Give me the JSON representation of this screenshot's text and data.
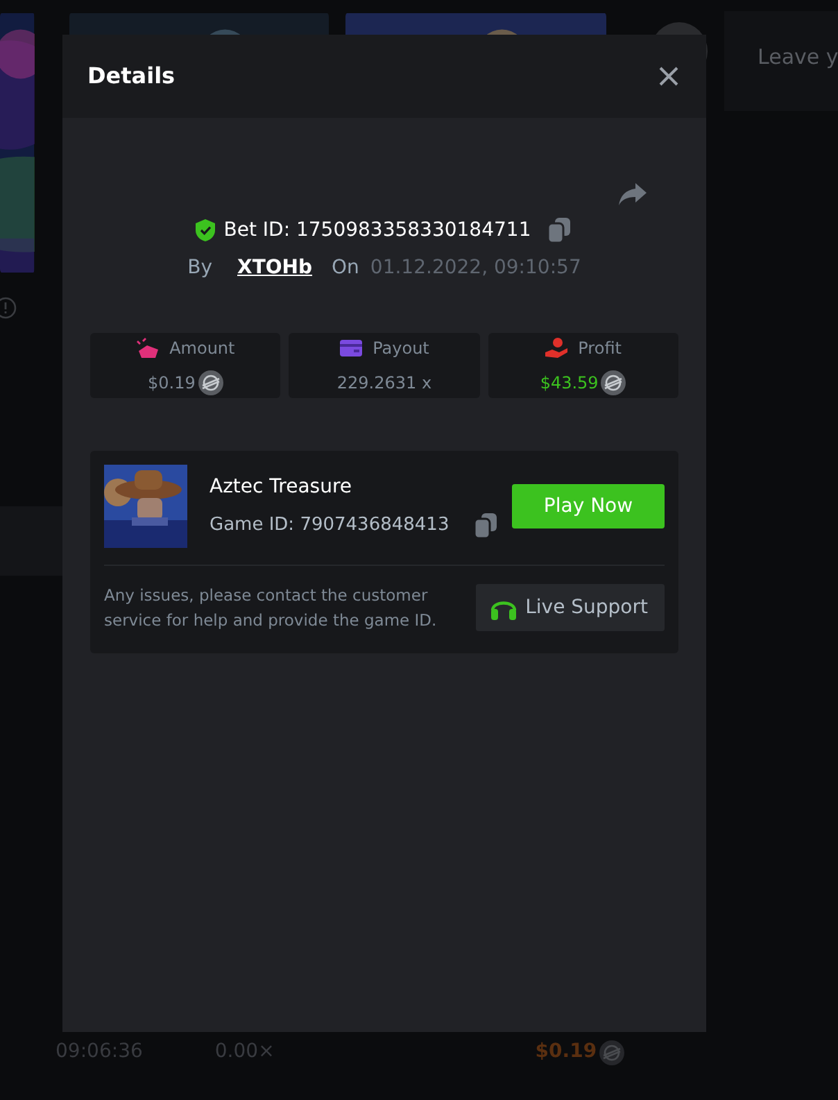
{
  "background": {
    "search_placeholder": "Leave y",
    "last_row": {
      "time": "09:06:36",
      "multiplier": "0.00×",
      "amount": "$0.19"
    }
  },
  "modal": {
    "title": "Details",
    "bet_id_label": "Bet ID:",
    "bet_id": "1750983358330184711",
    "by_label": "By",
    "user": "XTOHb",
    "on_label": "On",
    "date": "01.12.2022, 09:10:57",
    "stats": [
      {
        "kind": "amount",
        "label": "Amount",
        "value": "$0.19",
        "highlight": false,
        "coin": true
      },
      {
        "kind": "payout",
        "label": "Payout",
        "value": "229.2631 x",
        "highlight": false,
        "coin": false
      },
      {
        "kind": "profit",
        "label": "Profit",
        "value": "$43.59",
        "highlight": true,
        "coin": true
      }
    ],
    "game": {
      "name": "Aztec Treasure",
      "id_label": "Game ID:",
      "id": "7907436848413",
      "play_button": "Play Now",
      "help": "Any issues, please contact the customer service for help and provide the game ID.",
      "support_button": "Live Support"
    }
  }
}
